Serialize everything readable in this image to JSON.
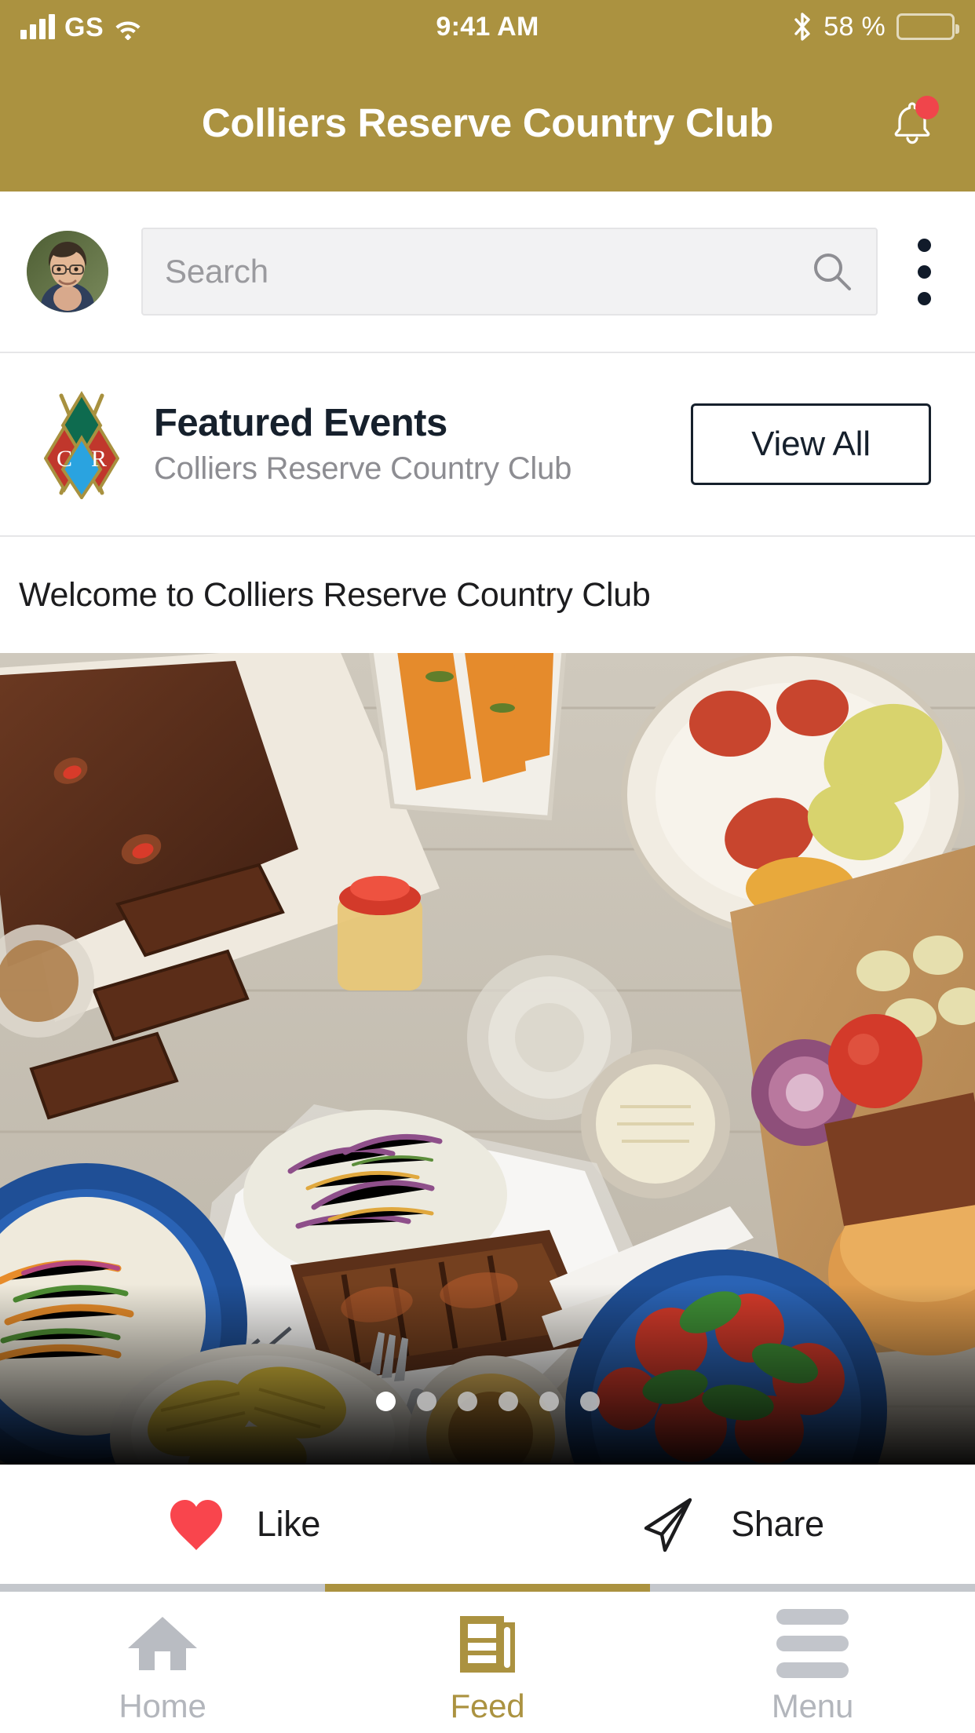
{
  "status_bar": {
    "carrier": "GS",
    "signal_icon": "signal-bars-icon",
    "wifi_icon": "wifi-icon",
    "time": "9:41 AM",
    "bluetooth_icon": "bluetooth-icon",
    "battery_percent": "58 %",
    "battery_icon": "battery-icon",
    "battery_level": 58
  },
  "header": {
    "title": "Colliers Reserve Country Club",
    "notification_icon": "bell-icon",
    "has_notification_badge": true,
    "background_color": "#AB9240"
  },
  "search": {
    "avatar_icon": "user-avatar",
    "placeholder": "Search",
    "value": "",
    "search_icon": "search-icon",
    "overflow_icon": "kebab-menu-icon"
  },
  "featured": {
    "logo_icon": "colliers-reserve-crest-logo",
    "title": "Featured Events",
    "subtitle": "Colliers Reserve Country Club",
    "view_all_label": "View All"
  },
  "post": {
    "caption": "Welcome to Colliers Reserve Country Club",
    "image_alt": "bbq-feast-photo",
    "carousel": {
      "total": 6,
      "active_index": 0
    },
    "like_label": "Like",
    "like_icon": "heart-icon",
    "like_color": "#F9454D",
    "share_label": "Share",
    "share_icon": "paper-plane-icon"
  },
  "tab_bar": {
    "active_index": 1,
    "accent_color": "#AB9240",
    "inactive_color": "#b3b6bc",
    "items": [
      {
        "label": "Home",
        "icon": "home-icon"
      },
      {
        "label": "Feed",
        "icon": "newspaper-icon"
      },
      {
        "label": "Menu",
        "icon": "hamburger-menu-icon"
      }
    ]
  }
}
